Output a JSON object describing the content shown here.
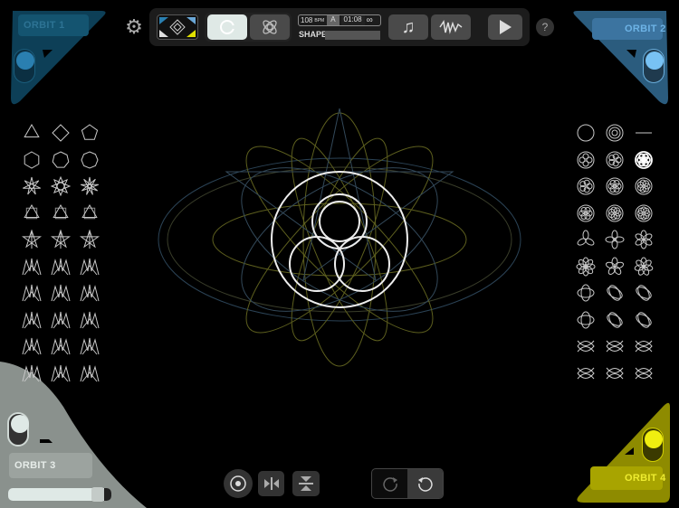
{
  "toolbar": {
    "bpm_value": "108",
    "bpm_unit": "BPM",
    "mode": "A",
    "time": "01:08",
    "loop": "∞",
    "shape_label": "SHAPE",
    "help": "?"
  },
  "orbits": [
    {
      "label": "ORBIT 1",
      "color": "#1e5f7e",
      "active": false
    },
    {
      "label": "ORBIT 2",
      "color": "#4e86ad",
      "active": true
    },
    {
      "label": "ORBIT 3",
      "color": "#8e9590",
      "active": true,
      "slider": 0.9
    },
    {
      "label": "ORBIT 4",
      "color": "#a7a400",
      "active": true
    }
  ],
  "left_shapes": [
    "triangle",
    "diamond",
    "pentagon",
    "hexagon",
    "heptagon",
    "octagon",
    "star6",
    "star8a",
    "star8b",
    "star-tri",
    "square-cross",
    "pyramid",
    "star-a",
    "star-b",
    "star-c",
    "crown-a",
    "crown-b",
    "crown-c",
    "lotus-a",
    "lotus-b",
    "lotus-c",
    "leaf-a",
    "leaf-b",
    "leaf-c",
    "fold-a",
    "fold-b",
    "fold-c",
    "zig-a",
    "zig-b",
    "zig-c"
  ],
  "right_shapes": [
    "circle",
    "spiral",
    "line",
    "ring-dot",
    "double-ring",
    "trefoil",
    "flower4",
    "flower5",
    "ring-in",
    "flower6",
    "flower7",
    "ring-dots",
    "rose8",
    "propeller",
    "clover",
    "daisy",
    "daisy2",
    "swirl",
    "bowtie",
    "weave",
    "weave2",
    "lens-a",
    "eye",
    "double-lens",
    "knot-a",
    "knot-b",
    "knot-c",
    "knot-d",
    "orb",
    "crossleaf"
  ],
  "bottom": {
    "direction_selected": "counter-clockwise"
  }
}
